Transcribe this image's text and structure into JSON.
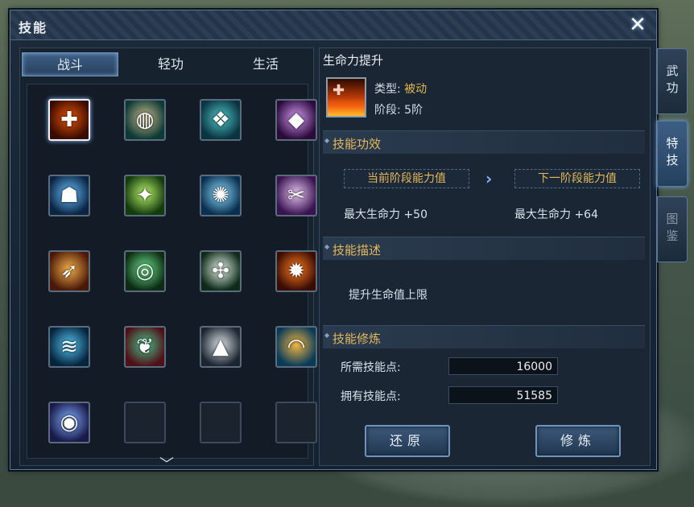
{
  "window": {
    "title": "技能",
    "close_label": "✕"
  },
  "tabs": [
    {
      "label": "战斗",
      "active": true
    },
    {
      "label": "轻功",
      "active": false
    },
    {
      "label": "生活",
      "active": false
    }
  ],
  "skills": [
    {
      "icon": "health-boost-icon",
      "glyph": "✚",
      "colors": [
        "#3a0a00",
        "#e8560b"
      ],
      "selected": true
    },
    {
      "icon": "turtle-shell-icon",
      "glyph": "◍",
      "colors": [
        "#0d3a36",
        "#c9b88a"
      ]
    },
    {
      "icon": "water-beast-icon",
      "glyph": "❖",
      "colors": [
        "#0a3340",
        "#4fc7c8"
      ]
    },
    {
      "icon": "purple-orb-icon",
      "glyph": "◆",
      "colors": [
        "#2b0b3b",
        "#d29af0"
      ]
    },
    {
      "icon": "ghost-spirit-icon",
      "glyph": "☗",
      "colors": [
        "#0a2544",
        "#6ac1ff"
      ]
    },
    {
      "icon": "green-blade-icon",
      "glyph": "✦",
      "colors": [
        "#143b0d",
        "#b8f06a"
      ]
    },
    {
      "icon": "water-splash-icon",
      "glyph": "✺",
      "colors": [
        "#0a3050",
        "#8ddcff"
      ]
    },
    {
      "icon": "purple-axe-icon",
      "glyph": "✂",
      "colors": [
        "#3a1450",
        "#e6c2f0"
      ]
    },
    {
      "icon": "golden-spear-icon",
      "glyph": "➶",
      "colors": [
        "#4a1808",
        "#f2b04a"
      ]
    },
    {
      "icon": "green-whirl-icon",
      "glyph": "◎",
      "colors": [
        "#0c2c14",
        "#6be08a"
      ]
    },
    {
      "icon": "shuriken-icon",
      "glyph": "✣",
      "colors": [
        "#0e2a18",
        "#e4f2ea"
      ]
    },
    {
      "icon": "fire-burst-icon",
      "glyph": "✹",
      "colors": [
        "#3a0d04",
        "#ff7a20"
      ]
    },
    {
      "icon": "ocean-wave-icon",
      "glyph": "≋",
      "colors": [
        "#06243e",
        "#53c3f0"
      ]
    },
    {
      "icon": "jade-vine-icon",
      "glyph": "❦",
      "colors": [
        "#501018",
        "#46c08a"
      ]
    },
    {
      "icon": "stone-spike-icon",
      "glyph": "▲",
      "colors": [
        "#1c2530",
        "#d8dfe6"
      ]
    },
    {
      "icon": "sand-dune-icon",
      "glyph": "◠",
      "colors": [
        "#0a3a5a",
        "#f0b640"
      ]
    },
    {
      "icon": "vortex-icon",
      "glyph": "◉",
      "colors": [
        "#1a1a4a",
        "#7fb0ff"
      ]
    },
    {
      "icon": "",
      "empty": true
    },
    {
      "icon": "",
      "empty": true
    },
    {
      "icon": "",
      "empty": true
    }
  ],
  "detail": {
    "name": "生命力提升",
    "type_label": "类型:",
    "type_value": "被动",
    "stage_label": "阶段:",
    "stage_value": "5阶",
    "effect_header": "技能功效",
    "current_label": "当前阶段能力值",
    "next_label": "下一阶段能力值",
    "current_value": "最大生命力 +50",
    "next_value": "最大生命力 +64",
    "desc_header": "技能描述",
    "description": "提升生命值上限",
    "train_header": "技能修炼",
    "required_label": "所需技能点:",
    "required_value": "16000",
    "owned_label": "拥有技能点:",
    "owned_value": "51585",
    "reset_button": "还原",
    "train_button": "修炼"
  },
  "side_tabs": [
    {
      "label": "武功",
      "state": "normal"
    },
    {
      "label": "特技",
      "state": "active"
    },
    {
      "label": "图鉴",
      "state": "dim"
    }
  ]
}
